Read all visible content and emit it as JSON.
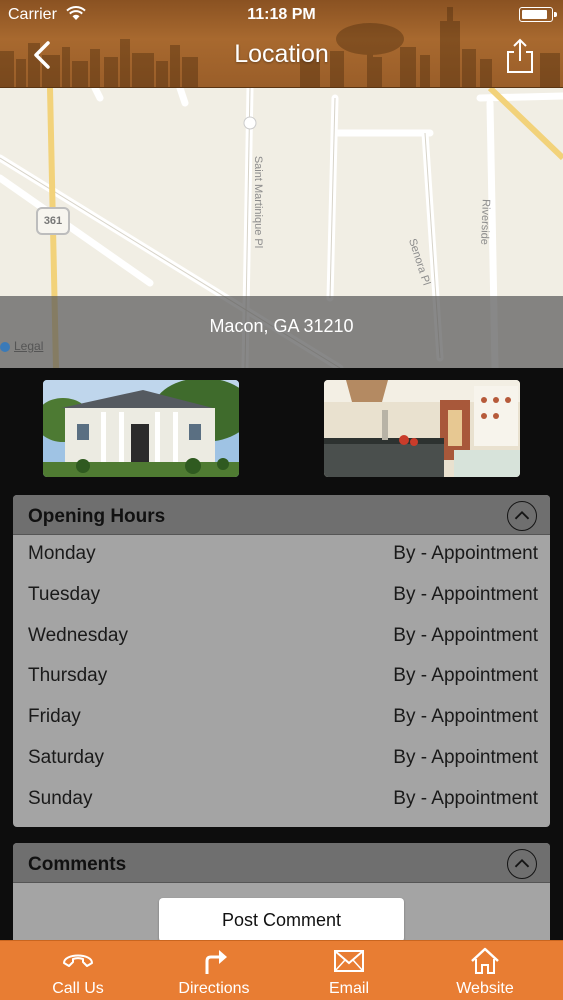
{
  "status_bar": {
    "carrier": "Carrier",
    "time": "11:18 PM",
    "battery_level": 0.95
  },
  "header": {
    "title": "Location",
    "back_icon": "chevron-left-icon",
    "share_icon": "share-icon"
  },
  "map": {
    "address": "Macon, GA 31210",
    "legal_label": "Legal",
    "route_shield": "361",
    "street_labels": [
      "Saint Martinique Pl",
      "Senora Pl",
      "Riverside"
    ]
  },
  "photos": [
    {
      "name": "house-exterior-photo"
    },
    {
      "name": "kitchen-interior-photo"
    }
  ],
  "opening_hours": {
    "title": "Opening Hours",
    "rows": [
      {
        "day": "Monday",
        "value": "By - Appointment"
      },
      {
        "day": "Tuesday",
        "value": "By - Appointment"
      },
      {
        "day": "Wednesday",
        "value": "By - Appointment"
      },
      {
        "day": "Thursday",
        "value": "By - Appointment"
      },
      {
        "day": "Friday",
        "value": "By - Appointment"
      },
      {
        "day": "Saturday",
        "value": "By - Appointment"
      },
      {
        "day": "Sunday",
        "value": "By - Appointment"
      }
    ]
  },
  "comments": {
    "title": "Comments",
    "post_button": "Post Comment"
  },
  "tabbar": {
    "color": "#e87d33",
    "items": [
      {
        "label": "Call Us",
        "icon": "phone-icon"
      },
      {
        "label": "Directions",
        "icon": "directions-arrow-icon"
      },
      {
        "label": "Email",
        "icon": "envelope-icon"
      },
      {
        "label": "Website",
        "icon": "home-icon"
      }
    ]
  }
}
